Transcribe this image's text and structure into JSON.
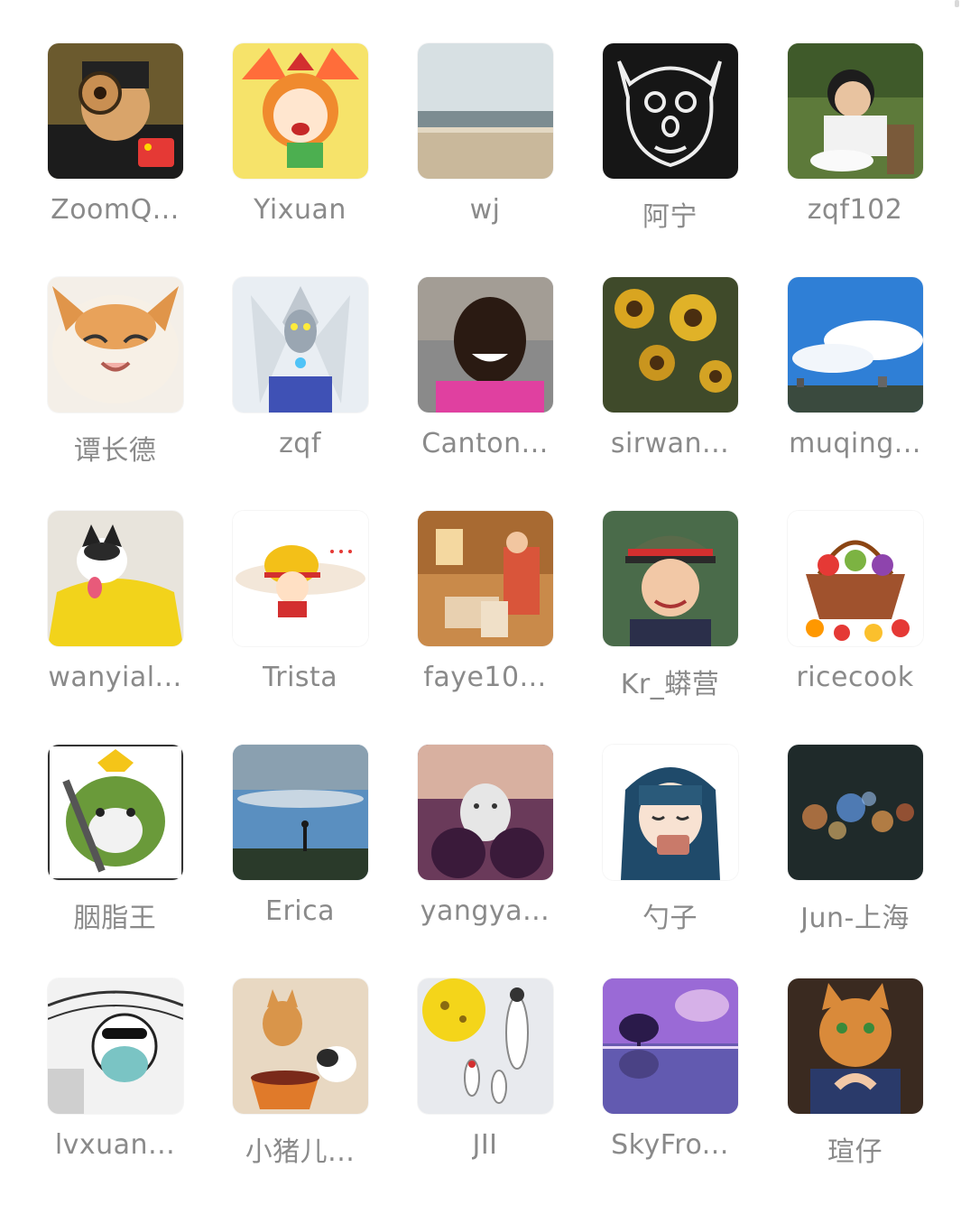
{
  "members": [
    {
      "name": "ZoomQ...",
      "icon": "man-with-magnifier-avatar"
    },
    {
      "name": "Yixuan",
      "icon": "anime-girl-avatar"
    },
    {
      "name": "wj",
      "icon": "beach-avatar"
    },
    {
      "name": "阿宁",
      "icon": "doodle-face-avatar"
    },
    {
      "name": "zqf102",
      "icon": "child-painting-avatar"
    },
    {
      "name": "谭长德",
      "icon": "smiling-cat-avatar"
    },
    {
      "name": "zqf",
      "icon": "ultraman-avatar"
    },
    {
      "name": "Canton...",
      "icon": "smiling-man-avatar"
    },
    {
      "name": "sirwan...",
      "icon": "sunflowers-avatar"
    },
    {
      "name": "muqing...",
      "icon": "blue-sky-avatar"
    },
    {
      "name": "wanyial...",
      "icon": "husky-dog-avatar"
    },
    {
      "name": "Trista",
      "icon": "straw-hat-cartoon-avatar"
    },
    {
      "name": "faye10...",
      "icon": "reading-woman-avatar"
    },
    {
      "name": "Kr_蟒营",
      "icon": "boy-in-cap-avatar"
    },
    {
      "name": "ricecook",
      "icon": "vegetable-basket-avatar"
    },
    {
      "name": "胭脂王",
      "icon": "cartoon-cat-warrior-avatar"
    },
    {
      "name": "Erica",
      "icon": "sky-silhouette-avatar"
    },
    {
      "name": "yangya...",
      "icon": "kitten-in-hands-avatar"
    },
    {
      "name": "勺子",
      "icon": "anime-girl-camera-avatar"
    },
    {
      "name": "Jun-上海",
      "icon": "bokeh-lights-avatar"
    },
    {
      "name": "lvxuan...",
      "icon": "sketch-man-mask-avatar"
    },
    {
      "name": "小猪儿...",
      "icon": "cats-with-bowl-avatar"
    },
    {
      "name": "JII",
      "icon": "illustration-figures-avatar"
    },
    {
      "name": "SkyFro...",
      "icon": "purple-lake-avatar"
    },
    {
      "name": "瑄仔",
      "icon": "cat-head-person-avatar"
    }
  ]
}
